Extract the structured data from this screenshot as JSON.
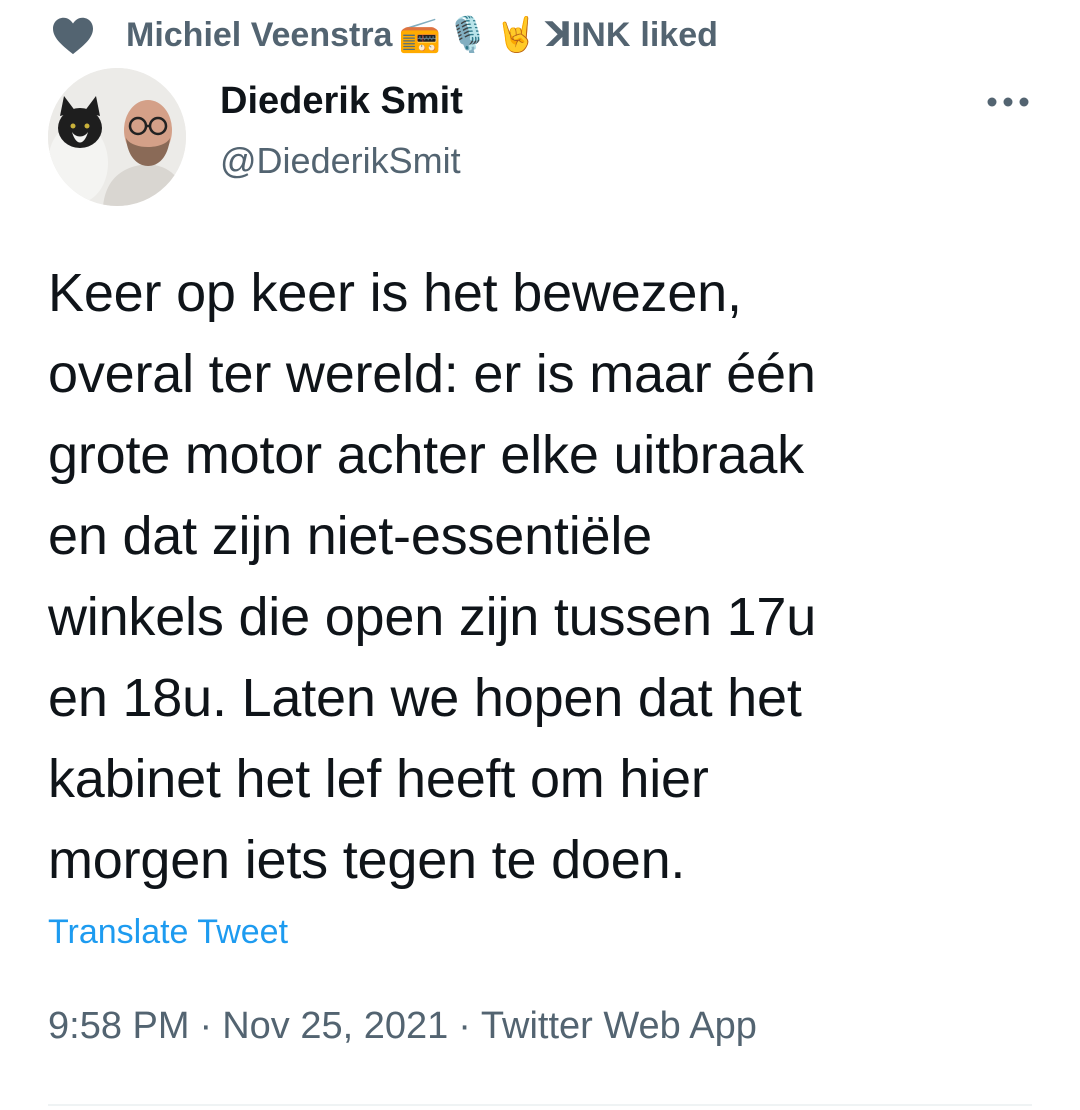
{
  "social_context": {
    "liker_name": "Michiel Veenstra",
    "emojis": [
      "📻",
      "🎙️",
      "🤘"
    ],
    "other_liker": "ꓘINK",
    "suffix": "liked"
  },
  "tweet": {
    "author_name": "Diederik Smit",
    "author_handle": "@DiederikSmit",
    "text": "Keer op keer is het bewezen,\noveral ter wereld: er is maar één\ngrote motor achter elke uitbraak\nen dat zijn niet-essentiële\nwinkels die open zijn tussen 17u\nen 18u. Laten we hopen dat het\nkabinet het lef heeft om hier\nmorgen iets tegen te doen.",
    "translate_label": "Translate Tweet",
    "time": "9:58 PM",
    "date": "Nov 25, 2021",
    "source": "Twitter Web App",
    "separator": "·"
  },
  "icons": {
    "heart": "heart-icon",
    "more": "more-icon"
  },
  "colors": {
    "text_primary": "#0f1419",
    "text_secondary": "#536471",
    "link": "#1d9bf0",
    "heart": "#536471"
  }
}
